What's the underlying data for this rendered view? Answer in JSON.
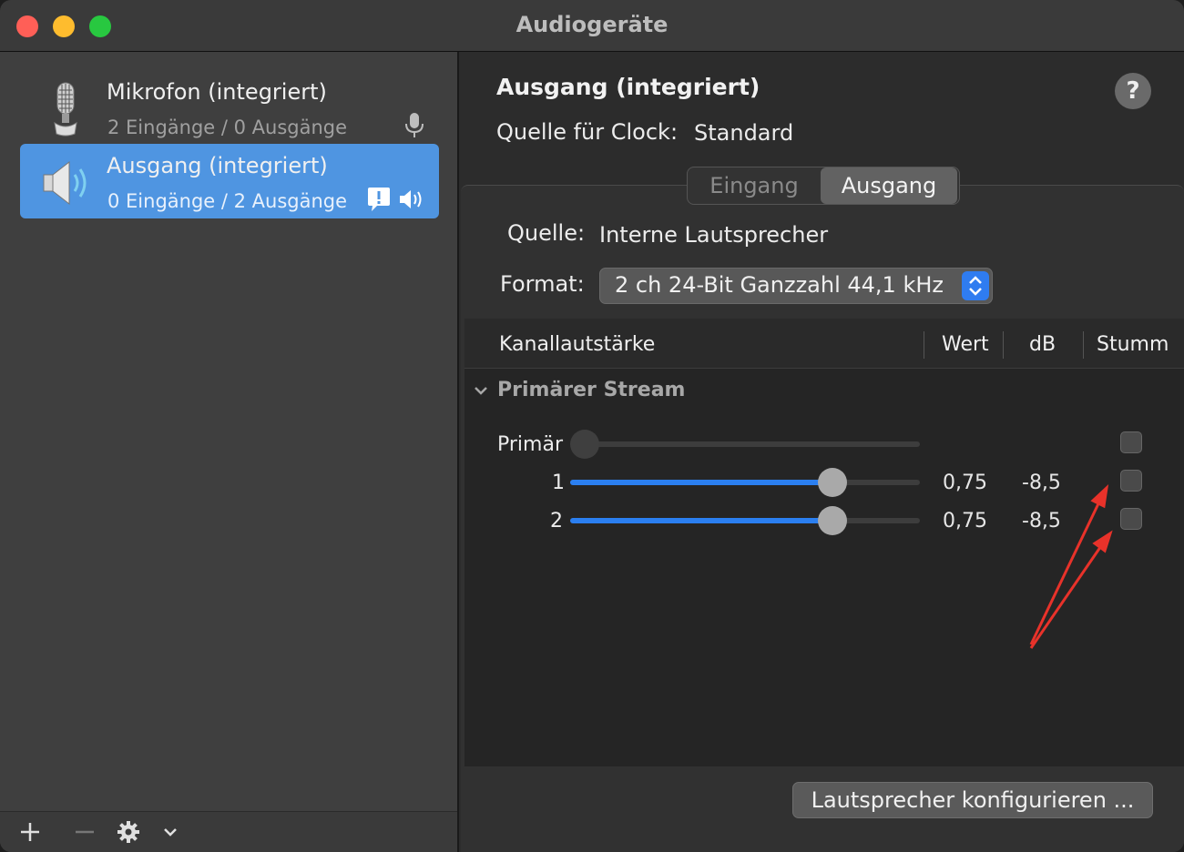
{
  "window": {
    "title": "Audiogeräte"
  },
  "sidebar": {
    "devices": [
      {
        "name": "Mikrofon (integriert)",
        "sub": "2 Eingänge / 0 Ausgänge",
        "icon": "microphone-icon",
        "badges": [
          "mic-small-icon"
        ]
      },
      {
        "name": "Ausgang (integriert)",
        "sub": "0 Eingänge / 2 Ausgänge",
        "icon": "speaker-icon",
        "badges": [
          "alert-bubble-icon",
          "speaker-small-icon"
        ]
      }
    ],
    "footer": {
      "add": "+",
      "remove": "—"
    }
  },
  "detail": {
    "title": "Ausgang (integriert)",
    "help": "?",
    "clock_label": "Quelle für Clock:",
    "clock_value": "Standard",
    "tabs": {
      "input": "Eingang",
      "output": "Ausgang",
      "active": "output"
    },
    "source_label": "Quelle:",
    "source_value": "Interne Lautsprecher",
    "format_label": "Format:",
    "format_value": "2 ch 24-Bit Ganzzahl 44,1 kHz",
    "table": {
      "headers": {
        "channel": "Kanallautstärke",
        "value": "Wert",
        "db": "dB",
        "mute": "Stumm"
      },
      "group": "Primärer Stream",
      "rows": [
        {
          "label": "Primär",
          "level": 0.0,
          "value": "",
          "db": "",
          "muted": false,
          "enabled": false
        },
        {
          "label": "1",
          "level": 0.75,
          "value": "0,75",
          "db": "-8,5",
          "muted": false,
          "enabled": true
        },
        {
          "label": "2",
          "level": 0.75,
          "value": "0,75",
          "db": "-8,5",
          "muted": false,
          "enabled": true
        }
      ]
    },
    "configure_button": "Lautsprecher konfigurieren ..."
  },
  "colors": {
    "accent": "#2b7ff0",
    "selection": "#4f95e1",
    "annotation": "#e8322a"
  }
}
